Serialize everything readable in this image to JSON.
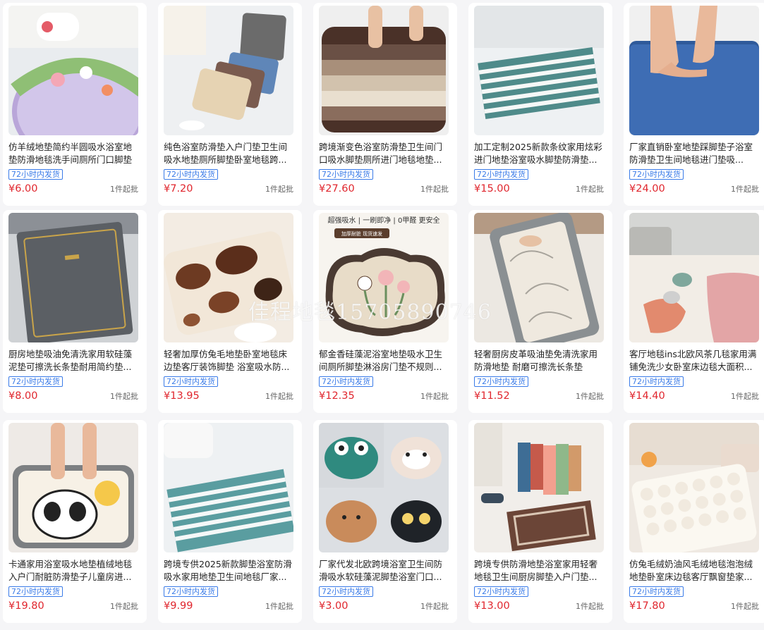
{
  "products": [
    {
      "title": "仿羊绒地垫简约半圆吸水浴室地垫防滑地毯洗手间厕所门口脚垫",
      "badge": "72小时内发货",
      "price": "¥6.00",
      "moq": "1件起批"
    },
    {
      "title": "纯色浴室防滑垫入户门垫卫生间吸水地垫厕所脚垫卧室地毯跨...",
      "badge": "72小时内发货",
      "price": "¥7.20",
      "moq": "1件起批"
    },
    {
      "title": "跨境渐变色浴室防滑垫卫生间门口吸水脚垫厕所进门地毯地垫...",
      "badge": "72小时内发货",
      "price": "¥27.60",
      "moq": "1件起批"
    },
    {
      "title": "加工定制2025新款条纹家用炫彩进门地垫浴室吸水脚垫防滑垫...",
      "badge": "72小时内发货",
      "price": "¥15.00",
      "moq": "1件起批"
    },
    {
      "title": "厂家直销卧室地垫踩脚垫子浴室防滑垫卫生间地毯进门垫吸...",
      "badge": "72小时内发货",
      "price": "¥24.00",
      "moq": "1件起批"
    },
    {
      "title": "厨房地垫吸油免清洗家用软硅藻泥垫可擦洗长条垫耐用简约垫...",
      "badge": "72小时内发货",
      "price": "¥8.00",
      "moq": "1件起批"
    },
    {
      "title": "轻奢加厚仿兔毛地垫卧室地毯床边垫客厅装饰脚垫 浴室吸水防...",
      "badge": "72小时内发货",
      "price": "¥13.95",
      "moq": "1件起批"
    },
    {
      "title": "郁金香硅藻泥浴室地垫吸水卫生间厕所脚垫淋浴房门垫不规则...",
      "badge": "72小时内发货",
      "price": "¥12.35",
      "moq": "1件起批"
    },
    {
      "title": "轻奢厨房皮革吸油垫免清洗家用防滑地垫 耐磨可擦洗长条垫",
      "badge": "72小时内发货",
      "price": "¥11.52",
      "moq": "1件起批"
    },
    {
      "title": "客厅地毯ins北欧风茶几毯家用满铺免洗少女卧室床边毯大面积...",
      "badge": "72小时内发货",
      "price": "¥14.40",
      "moq": "1件起批"
    },
    {
      "title": "卡通家用浴室吸水地垫植绒地毯入户门耐脏防滑垫子儿童房进...",
      "badge": "72小时内发货",
      "price": "¥19.80",
      "moq": "1件起批"
    },
    {
      "title": "跨境专供2025新款脚垫浴室防滑吸水家用地垫卫生间地毯厂家...",
      "badge": "72小时内发货",
      "price": "¥9.99",
      "moq": "1件起批"
    },
    {
      "title": "厂家代发北欧跨境浴室卫生间防滑吸水软硅藻泥脚垫浴室门口...",
      "badge": "72小时内发货",
      "price": "¥3.00",
      "moq": "1件起批"
    },
    {
      "title": "跨境专供防滑地垫浴室家用轻奢地毯卫生间厨房脚垫入户门垫...",
      "badge": "72小时内发货",
      "price": "¥13.00",
      "moq": "1件起批"
    },
    {
      "title": "仿兔毛绒奶油风毛绒地毯泡泡绒地垫卧室床边毯客厅飘窗垫家...",
      "badge": "72小时内发货",
      "price": "¥17.80",
      "moq": "1件起批"
    }
  ],
  "image_texts": {
    "p3_banner": "超强吸水 | 一刷即净 | 0甲醛 更安全",
    "p3_badges": "加厚耐脏  现货速发"
  },
  "watermark": "佳程地毯15705890746"
}
